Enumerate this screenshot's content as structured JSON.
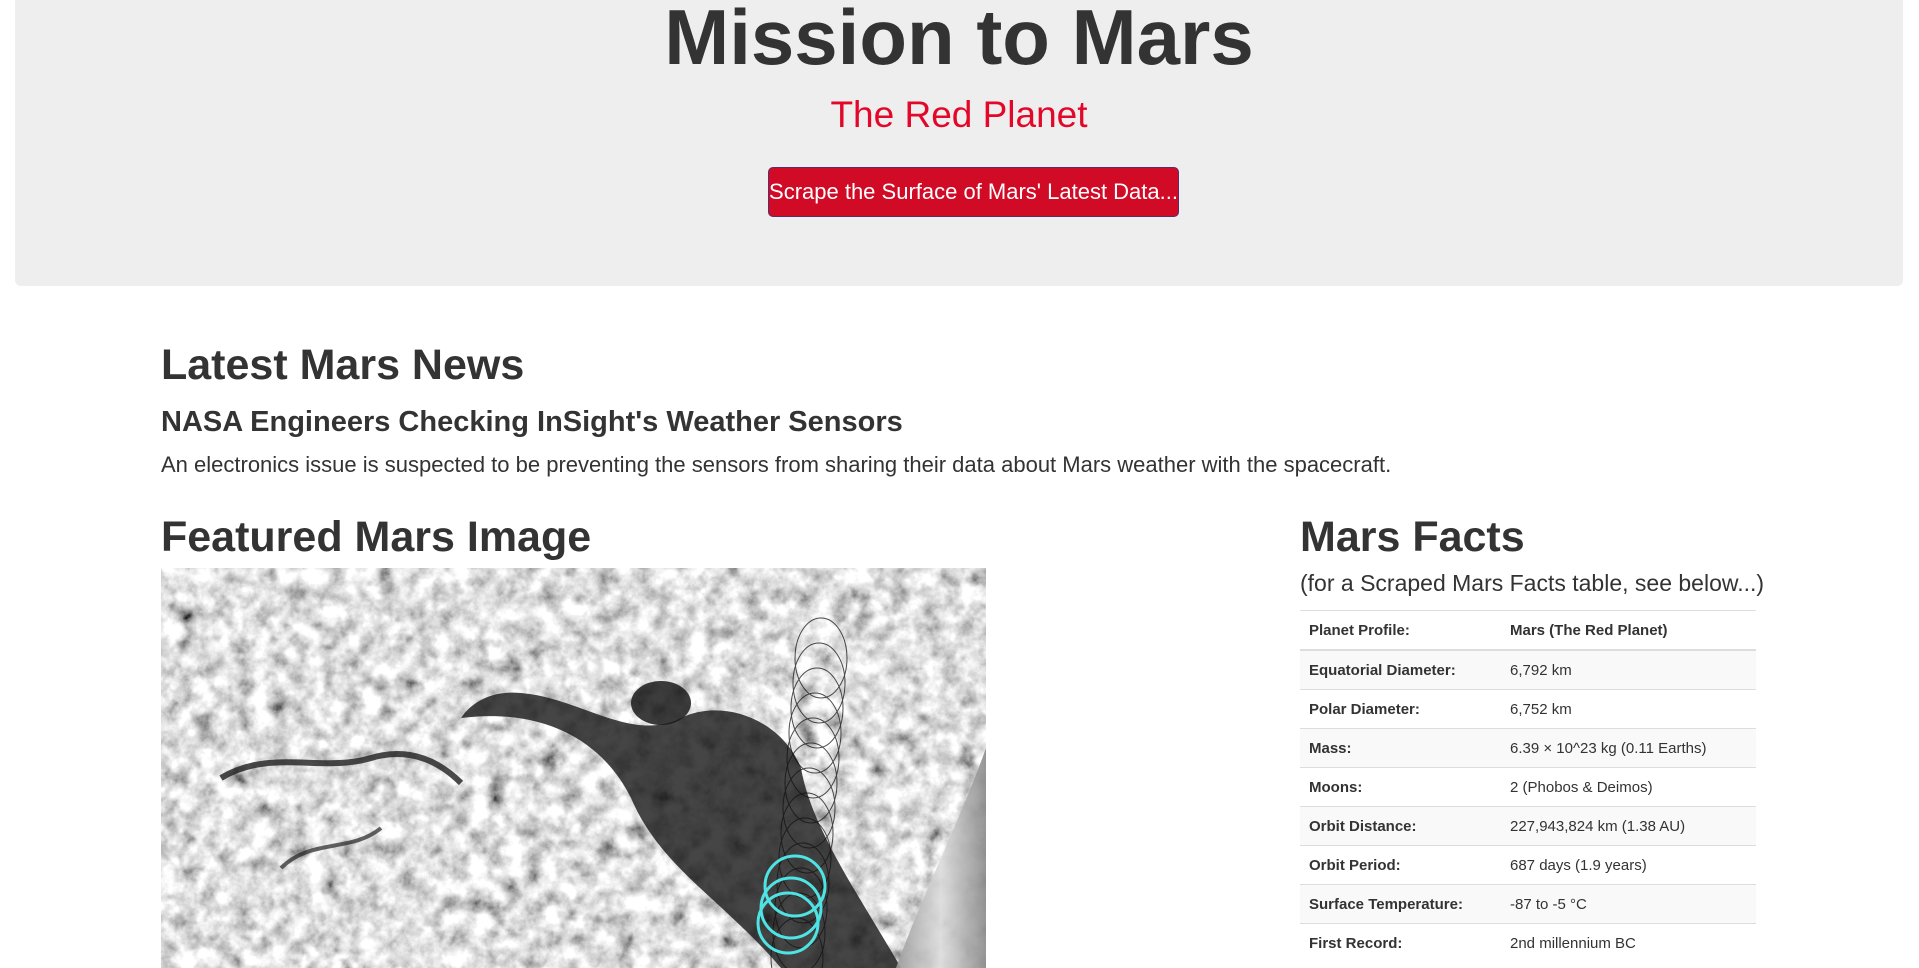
{
  "header": {
    "title": "Mission to Mars",
    "subtitle": "The Red Planet",
    "scrape_button_label": "Scrape the Surface of Mars' Latest Data..."
  },
  "news": {
    "heading": "Latest Mars News",
    "title": "NASA Engineers Checking InSight's Weather Sensors",
    "teaser": "An electronics issue is suspected to be preventing the sensors from sharing their data about Mars weather with the spacecraft."
  },
  "featured": {
    "heading": "Featured Mars Image"
  },
  "facts": {
    "heading": "Mars Facts",
    "note": "(for a Scraped Mars Facts table, see below...)",
    "header_label": "Planet Profile:",
    "header_value": "Mars (The Red Planet)",
    "rows": [
      {
        "label": "Equatorial Diameter:",
        "value": "6,792 km"
      },
      {
        "label": "Polar Diameter:",
        "value": "6,752 km"
      },
      {
        "label": "Mass:",
        "value": "6.39 × 10^23 kg (0.11 Earths)"
      },
      {
        "label": "Moons:",
        "value": "2 (Phobos & Deimos)"
      },
      {
        "label": "Orbit Distance:",
        "value": "227,943,824 km (1.38 AU)"
      },
      {
        "label": "Orbit Period:",
        "value": "687 days (1.9 years)"
      },
      {
        "label": "Surface Temperature:",
        "value": "-87 to -5 °C"
      },
      {
        "label": "First Record:",
        "value": "2nd millennium BC"
      }
    ]
  },
  "colors": {
    "accent": "#e3082a",
    "button": "#d10a26",
    "jumbotron": "#eeeeee"
  }
}
